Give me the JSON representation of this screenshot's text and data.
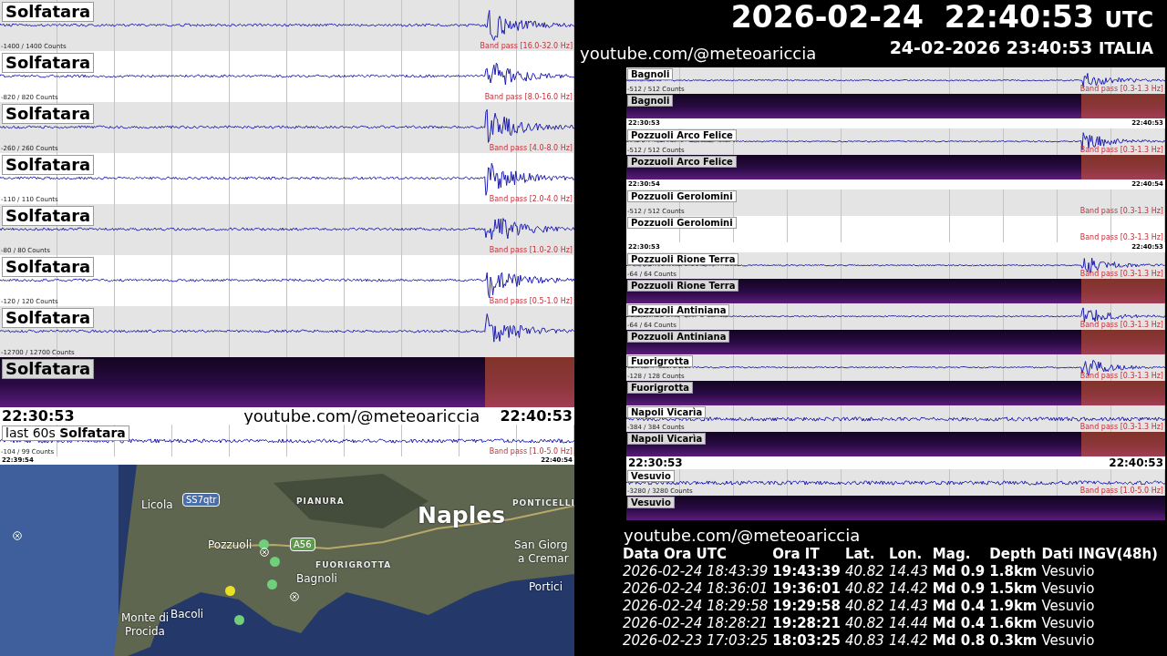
{
  "left": {
    "panels": [
      {
        "kind": "trace",
        "label": "Solfatara",
        "counts": "-1400 / 1400 Counts",
        "band": "Band pass [16.0-32.0 Hz]",
        "signal": true,
        "burst": true
      },
      {
        "kind": "trace",
        "label": "Solfatara",
        "counts": "-820 / 820 Counts",
        "band": "Band pass [8.0-16.0 Hz]",
        "signal": true,
        "burst": true
      },
      {
        "kind": "trace",
        "label": "Solfatara",
        "counts": "-260 / 260 Counts",
        "band": "Band pass [4.0-8.0 Hz]",
        "signal": true,
        "burst": true
      },
      {
        "kind": "trace",
        "label": "Solfatara",
        "counts": "-110 / 110 Counts",
        "band": "Band pass [2.0-4.0 Hz]",
        "signal": true,
        "burst": true
      },
      {
        "kind": "trace",
        "label": "Solfatara",
        "counts": "-80 / 80 Counts",
        "band": "Band pass [1.0-2.0 Hz]",
        "signal": true,
        "burst": true
      },
      {
        "kind": "trace",
        "label": "Solfatara",
        "counts": "-120 / 120 Counts",
        "band": "Band pass [0.5-1.0 Hz]",
        "signal": true,
        "burst": true
      },
      {
        "kind": "trace",
        "label": "Solfatara",
        "counts": "-12700 / 12700 Counts",
        "signal": true,
        "burst": true
      },
      {
        "kind": "spectrogram",
        "label": "Solfatara",
        "burst": true
      },
      {
        "kind": "timebar-large",
        "start": "22:30:53",
        "middle": "youtube.com/@meteoariccia",
        "end": "22:40:53"
      },
      {
        "kind": "trace-mini",
        "label": "last 60s **Solfatara**",
        "counts": "-104 / 99 Counts",
        "band": "Band pass [1.0-5.0 Hz]",
        "signal": true,
        "burst": false
      },
      {
        "kind": "timebar",
        "start": "22:39:54",
        "end": "22:40:54"
      }
    ],
    "map": {
      "labels": [
        {
          "text": "Licola",
          "kind": "place"
        },
        {
          "text": "SS7qtr",
          "kind": "shield",
          "color": "#4a6fa8"
        },
        {
          "text": "PIANURA",
          "kind": "district"
        },
        {
          "text": "Naples",
          "kind": "city"
        },
        {
          "text": "PONTICELLI",
          "kind": "district"
        },
        {
          "text": "Pozzuoli",
          "kind": "place"
        },
        {
          "text": "A56",
          "kind": "shield",
          "color": "#5f9a4a"
        },
        {
          "text": "San Giorg",
          "kind": "place"
        },
        {
          "text": "a Cremar",
          "kind": "place"
        },
        {
          "text": "FUORIGROTTA",
          "kind": "district"
        },
        {
          "text": "Bagnoli",
          "kind": "place"
        },
        {
          "text": "Portici",
          "kind": "place"
        },
        {
          "text": "Monte di",
          "kind": "place"
        },
        {
          "text": "Procida",
          "kind": "place"
        },
        {
          "text": "Bacoli",
          "kind": "place"
        }
      ],
      "events": [
        {
          "kind": "cross"
        },
        {
          "kind": "dot",
          "color": "#6fcf7a"
        },
        {
          "kind": "cross"
        },
        {
          "kind": "dot",
          "color": "#6fcf7a"
        },
        {
          "kind": "dot",
          "color": "#6fcf7a"
        },
        {
          "kind": "dot",
          "color": "#e8e020"
        },
        {
          "kind": "cross"
        },
        {
          "kind": "dot",
          "color": "#6fcf7a"
        }
      ]
    }
  },
  "header": {
    "date_time": "2026-02-24  22:40:53",
    "zone": "UTC",
    "channel": "youtube.com/@meteoariccia",
    "local_time": "24-02-2026 23:40:53",
    "local_zone": "ITALIA"
  },
  "right": {
    "panels": [
      {
        "kind": "trace",
        "label": "Bagnoli",
        "counts": "-512 / 512 Counts",
        "band": "Band pass [0.3-1.3 Hz]",
        "signal": true,
        "burst": true
      },
      {
        "kind": "spectrogram",
        "label": "Bagnoli",
        "burst": true
      },
      {
        "kind": "timebar",
        "start": "22:30:53",
        "end": "22:40:53"
      },
      {
        "kind": "trace",
        "label": "Pozzuoli Arco Felice",
        "counts": "-512 / 512 Counts",
        "band": "Band pass [0.3-1.3 Hz]",
        "signal": true,
        "burst": true
      },
      {
        "kind": "spectrogram",
        "label": "Pozzuoli Arco Felice",
        "burst": true
      },
      {
        "kind": "timebar",
        "start": "22:30:54",
        "end": "22:40:54"
      },
      {
        "kind": "trace",
        "label": "Pozzuoli Gerolomini",
        "counts": "-512 / 512 Counts",
        "band": "Band pass [0.3-1.3 Hz]",
        "signal": false
      },
      {
        "kind": "blank",
        "label": "Pozzuoli Gerolomini",
        "band": "Band pass [0.3-1.3 Hz]"
      },
      {
        "kind": "timebar",
        "start": "22:30:53",
        "end": "22:40:53"
      },
      {
        "kind": "trace",
        "label": "Pozzuoli Rione Terra",
        "counts": "-64 / 64 Counts",
        "band": "Band pass [0.3-1.3 Hz]",
        "signal": true,
        "burst": true
      },
      {
        "kind": "spectrogram",
        "label": "Pozzuoli Rione Terra",
        "burst": true
      },
      {
        "kind": "trace",
        "label": "Pozzuoli Antiniana",
        "counts": "-64 / 64 Counts",
        "band": "Band pass [0.3-1.3 Hz]",
        "signal": true,
        "burst": true
      },
      {
        "kind": "spectrogram",
        "label": "Pozzuoli Antiniana",
        "burst": true
      },
      {
        "kind": "trace",
        "label": "Fuorigrotta",
        "counts": "-128 / 128 Counts",
        "band": "Band pass [0.3-1.3 Hz]",
        "signal": true,
        "burst": true
      },
      {
        "kind": "spectrogram",
        "label": "Fuorigrotta",
        "burst": true
      },
      {
        "kind": "trace",
        "label": "Napoli Vicarìa",
        "counts": "-384 / 384 Counts",
        "band": "Band pass [0.3-1.3 Hz]",
        "signal": true,
        "burst": false
      },
      {
        "kind": "spectrogram",
        "label": "Napoli Vicarìa",
        "burst": true
      },
      {
        "kind": "timebar-large",
        "start": "22:30:53",
        "end": "22:40:53"
      },
      {
        "kind": "trace",
        "label": "Vesuvio",
        "counts": "-3280 / 3280 Counts",
        "band": "Band pass [1.0-5.0 Hz]",
        "signal": true,
        "burst": false
      },
      {
        "kind": "spectrogram",
        "label": "Vesuvio",
        "burst": false
      }
    ]
  },
  "channel_footer": "youtube.com/@meteoariccia",
  "quakes": {
    "columns": [
      "Data Ora UTC",
      "Ora IT",
      "Lat.",
      "Lon.",
      "Mag.",
      "Depth",
      "Dati INGV(48h)"
    ],
    "rows": [
      [
        "2026-02-24 18:43:39",
        "19:43:39",
        "40.82",
        "14.43",
        "Md 0.9",
        "1.8km",
        "Vesuvio"
      ],
      [
        "2026-02-24 18:36:01",
        "19:36:01",
        "40.82",
        "14.42",
        "Md 0.9",
        "1.5km",
        "Vesuvio"
      ],
      [
        "2026-02-24 18:29:58",
        "19:29:58",
        "40.82",
        "14.43",
        "Md 0.4",
        "1.9km",
        "Vesuvio"
      ],
      [
        "2026-02-24 18:28:21",
        "19:28:21",
        "40.82",
        "14.44",
        "Md 0.4",
        "1.6km",
        "Vesuvio"
      ],
      [
        "2026-02-23 17:03:25",
        "18:03:25",
        "40.83",
        "14.42",
        "Md 0.8",
        "0.3km",
        "Vesuvio"
      ]
    ]
  }
}
